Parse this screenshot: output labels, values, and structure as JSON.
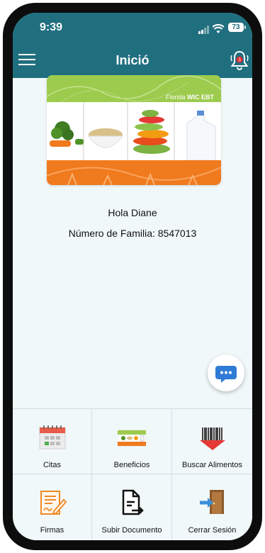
{
  "status_bar": {
    "time": "9:39",
    "battery": "73"
  },
  "header": {
    "title": "Inició",
    "menu_icon": "hamburger-menu-icon",
    "bell_icon": "bell-icon",
    "notification_count": "3"
  },
  "card": {
    "brand": "Florida",
    "brand_bold": "WIC EBT"
  },
  "greeting": "Hola Diane",
  "family_number": "Número de Familia: 8547013",
  "chat_icon": "chat-bubble-icon",
  "menu": [
    {
      "label": "Citas",
      "icon": "calendar-icon"
    },
    {
      "label": "Beneficios",
      "icon": "benefits-card-icon"
    },
    {
      "label": "Buscar Alimentos",
      "icon": "barcode-scan-icon"
    },
    {
      "label": "Firmas",
      "icon": "signature-document-icon"
    },
    {
      "label": "Subir Documento",
      "icon": "upload-document-icon"
    },
    {
      "label": "Cerrar Sesión",
      "icon": "logout-door-icon"
    }
  ],
  "colors": {
    "header": "#206f7f",
    "background": "#f1f8f9",
    "card_green": "#9ccb4e",
    "card_orange": "#f07a1e",
    "chat_blue": "#2f7bd6"
  }
}
